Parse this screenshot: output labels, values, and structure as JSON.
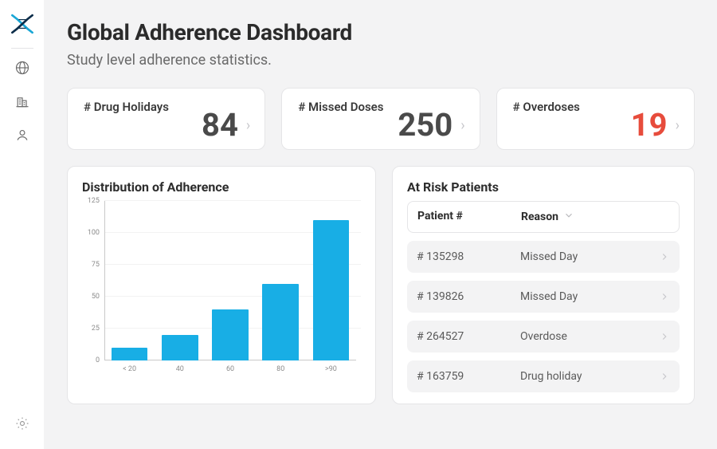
{
  "header": {
    "title": "Global Adherence Dashboard",
    "subtitle": "Study level adherence statistics."
  },
  "stats": {
    "holidays": {
      "label": "# Drug Holidays",
      "value": "84"
    },
    "missed": {
      "label": "# Missed Doses",
      "value": "250"
    },
    "over": {
      "label": "# Overdoses",
      "value": "19"
    }
  },
  "chart": {
    "title": "Distribution of Adherence"
  },
  "chart_data": {
    "type": "bar",
    "title": "Distribution of Adherence",
    "xlabel": "",
    "ylabel": "",
    "ylim": [
      0,
      125
    ],
    "categories": [
      "< 20",
      "40",
      "60",
      "80",
      ">90"
    ],
    "values": [
      10,
      20,
      40,
      60,
      110
    ]
  },
  "risk": {
    "title": "At Risk Patients",
    "cols": {
      "patient": "Patient #",
      "reason": "Reason"
    },
    "rows": [
      {
        "patient": "# 135298",
        "reason": "Missed Day"
      },
      {
        "patient": "# 139826",
        "reason": "Missed Day"
      },
      {
        "patient": "# 264527",
        "reason": "Overdose"
      },
      {
        "patient": "# 163759",
        "reason": "Drug holiday"
      }
    ]
  }
}
